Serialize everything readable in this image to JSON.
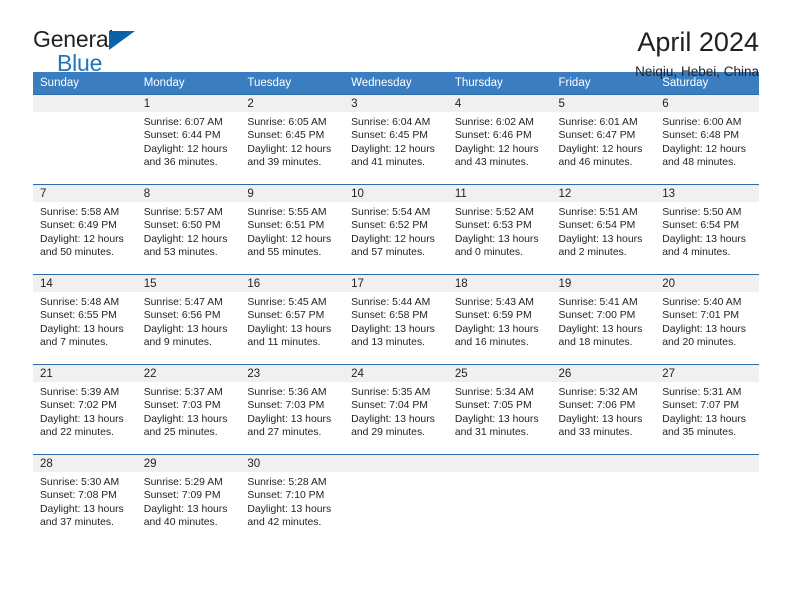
{
  "branding": {
    "logo_text_top": "General",
    "logo_text_bottom": "Blue",
    "logo_accent_color": "#0b62a9",
    "logo_blue_text_color": "#2175bb"
  },
  "header": {
    "title": "April 2024",
    "subtitle": "Neiqiu, Hebei, China"
  },
  "theme": {
    "header_bar_color": "#3a7dc0",
    "row_divider_color": "#2c6ca8",
    "daynum_band_color": "#f0f0f0",
    "text_color": "#231f20"
  },
  "columns": [
    "Sunday",
    "Monday",
    "Tuesday",
    "Wednesday",
    "Thursday",
    "Friday",
    "Saturday"
  ],
  "labels": {
    "sunrise_prefix": "Sunrise:",
    "sunset_prefix": "Sunset:",
    "daylight_prefix": "Daylight:"
  },
  "weeks": [
    [
      {
        "empty": true
      },
      {
        "day": "1",
        "sunrise": "Sunrise: 6:07 AM",
        "sunset": "Sunset: 6:44 PM",
        "daylight_1": "Daylight: 12 hours",
        "daylight_2": "and 36 minutes."
      },
      {
        "day": "2",
        "sunrise": "Sunrise: 6:05 AM",
        "sunset": "Sunset: 6:45 PM",
        "daylight_1": "Daylight: 12 hours",
        "daylight_2": "and 39 minutes."
      },
      {
        "day": "3",
        "sunrise": "Sunrise: 6:04 AM",
        "sunset": "Sunset: 6:45 PM",
        "daylight_1": "Daylight: 12 hours",
        "daylight_2": "and 41 minutes."
      },
      {
        "day": "4",
        "sunrise": "Sunrise: 6:02 AM",
        "sunset": "Sunset: 6:46 PM",
        "daylight_1": "Daylight: 12 hours",
        "daylight_2": "and 43 minutes."
      },
      {
        "day": "5",
        "sunrise": "Sunrise: 6:01 AM",
        "sunset": "Sunset: 6:47 PM",
        "daylight_1": "Daylight: 12 hours",
        "daylight_2": "and 46 minutes."
      },
      {
        "day": "6",
        "sunrise": "Sunrise: 6:00 AM",
        "sunset": "Sunset: 6:48 PM",
        "daylight_1": "Daylight: 12 hours",
        "daylight_2": "and 48 minutes."
      }
    ],
    [
      {
        "day": "7",
        "sunrise": "Sunrise: 5:58 AM",
        "sunset": "Sunset: 6:49 PM",
        "daylight_1": "Daylight: 12 hours",
        "daylight_2": "and 50 minutes."
      },
      {
        "day": "8",
        "sunrise": "Sunrise: 5:57 AM",
        "sunset": "Sunset: 6:50 PM",
        "daylight_1": "Daylight: 12 hours",
        "daylight_2": "and 53 minutes."
      },
      {
        "day": "9",
        "sunrise": "Sunrise: 5:55 AM",
        "sunset": "Sunset: 6:51 PM",
        "daylight_1": "Daylight: 12 hours",
        "daylight_2": "and 55 minutes."
      },
      {
        "day": "10",
        "sunrise": "Sunrise: 5:54 AM",
        "sunset": "Sunset: 6:52 PM",
        "daylight_1": "Daylight: 12 hours",
        "daylight_2": "and 57 minutes."
      },
      {
        "day": "11",
        "sunrise": "Sunrise: 5:52 AM",
        "sunset": "Sunset: 6:53 PM",
        "daylight_1": "Daylight: 13 hours",
        "daylight_2": "and 0 minutes."
      },
      {
        "day": "12",
        "sunrise": "Sunrise: 5:51 AM",
        "sunset": "Sunset: 6:54 PM",
        "daylight_1": "Daylight: 13 hours",
        "daylight_2": "and 2 minutes."
      },
      {
        "day": "13",
        "sunrise": "Sunrise: 5:50 AM",
        "sunset": "Sunset: 6:54 PM",
        "daylight_1": "Daylight: 13 hours",
        "daylight_2": "and 4 minutes."
      }
    ],
    [
      {
        "day": "14",
        "sunrise": "Sunrise: 5:48 AM",
        "sunset": "Sunset: 6:55 PM",
        "daylight_1": "Daylight: 13 hours",
        "daylight_2": "and 7 minutes."
      },
      {
        "day": "15",
        "sunrise": "Sunrise: 5:47 AM",
        "sunset": "Sunset: 6:56 PM",
        "daylight_1": "Daylight: 13 hours",
        "daylight_2": "and 9 minutes."
      },
      {
        "day": "16",
        "sunrise": "Sunrise: 5:45 AM",
        "sunset": "Sunset: 6:57 PM",
        "daylight_1": "Daylight: 13 hours",
        "daylight_2": "and 11 minutes."
      },
      {
        "day": "17",
        "sunrise": "Sunrise: 5:44 AM",
        "sunset": "Sunset: 6:58 PM",
        "daylight_1": "Daylight: 13 hours",
        "daylight_2": "and 13 minutes."
      },
      {
        "day": "18",
        "sunrise": "Sunrise: 5:43 AM",
        "sunset": "Sunset: 6:59 PM",
        "daylight_1": "Daylight: 13 hours",
        "daylight_2": "and 16 minutes."
      },
      {
        "day": "19",
        "sunrise": "Sunrise: 5:41 AM",
        "sunset": "Sunset: 7:00 PM",
        "daylight_1": "Daylight: 13 hours",
        "daylight_2": "and 18 minutes."
      },
      {
        "day": "20",
        "sunrise": "Sunrise: 5:40 AM",
        "sunset": "Sunset: 7:01 PM",
        "daylight_1": "Daylight: 13 hours",
        "daylight_2": "and 20 minutes."
      }
    ],
    [
      {
        "day": "21",
        "sunrise": "Sunrise: 5:39 AM",
        "sunset": "Sunset: 7:02 PM",
        "daylight_1": "Daylight: 13 hours",
        "daylight_2": "and 22 minutes."
      },
      {
        "day": "22",
        "sunrise": "Sunrise: 5:37 AM",
        "sunset": "Sunset: 7:03 PM",
        "daylight_1": "Daylight: 13 hours",
        "daylight_2": "and 25 minutes."
      },
      {
        "day": "23",
        "sunrise": "Sunrise: 5:36 AM",
        "sunset": "Sunset: 7:03 PM",
        "daylight_1": "Daylight: 13 hours",
        "daylight_2": "and 27 minutes."
      },
      {
        "day": "24",
        "sunrise": "Sunrise: 5:35 AM",
        "sunset": "Sunset: 7:04 PM",
        "daylight_1": "Daylight: 13 hours",
        "daylight_2": "and 29 minutes."
      },
      {
        "day": "25",
        "sunrise": "Sunrise: 5:34 AM",
        "sunset": "Sunset: 7:05 PM",
        "daylight_1": "Daylight: 13 hours",
        "daylight_2": "and 31 minutes."
      },
      {
        "day": "26",
        "sunrise": "Sunrise: 5:32 AM",
        "sunset": "Sunset: 7:06 PM",
        "daylight_1": "Daylight: 13 hours",
        "daylight_2": "and 33 minutes."
      },
      {
        "day": "27",
        "sunrise": "Sunrise: 5:31 AM",
        "sunset": "Sunset: 7:07 PM",
        "daylight_1": "Daylight: 13 hours",
        "daylight_2": "and 35 minutes."
      }
    ],
    [
      {
        "day": "28",
        "sunrise": "Sunrise: 5:30 AM",
        "sunset": "Sunset: 7:08 PM",
        "daylight_1": "Daylight: 13 hours",
        "daylight_2": "and 37 minutes."
      },
      {
        "day": "29",
        "sunrise": "Sunrise: 5:29 AM",
        "sunset": "Sunset: 7:09 PM",
        "daylight_1": "Daylight: 13 hours",
        "daylight_2": "and 40 minutes."
      },
      {
        "day": "30",
        "sunrise": "Sunrise: 5:28 AM",
        "sunset": "Sunset: 7:10 PM",
        "daylight_1": "Daylight: 13 hours",
        "daylight_2": "and 42 minutes."
      },
      {
        "empty": true
      },
      {
        "empty": true
      },
      {
        "empty": true
      },
      {
        "empty": true
      }
    ]
  ]
}
